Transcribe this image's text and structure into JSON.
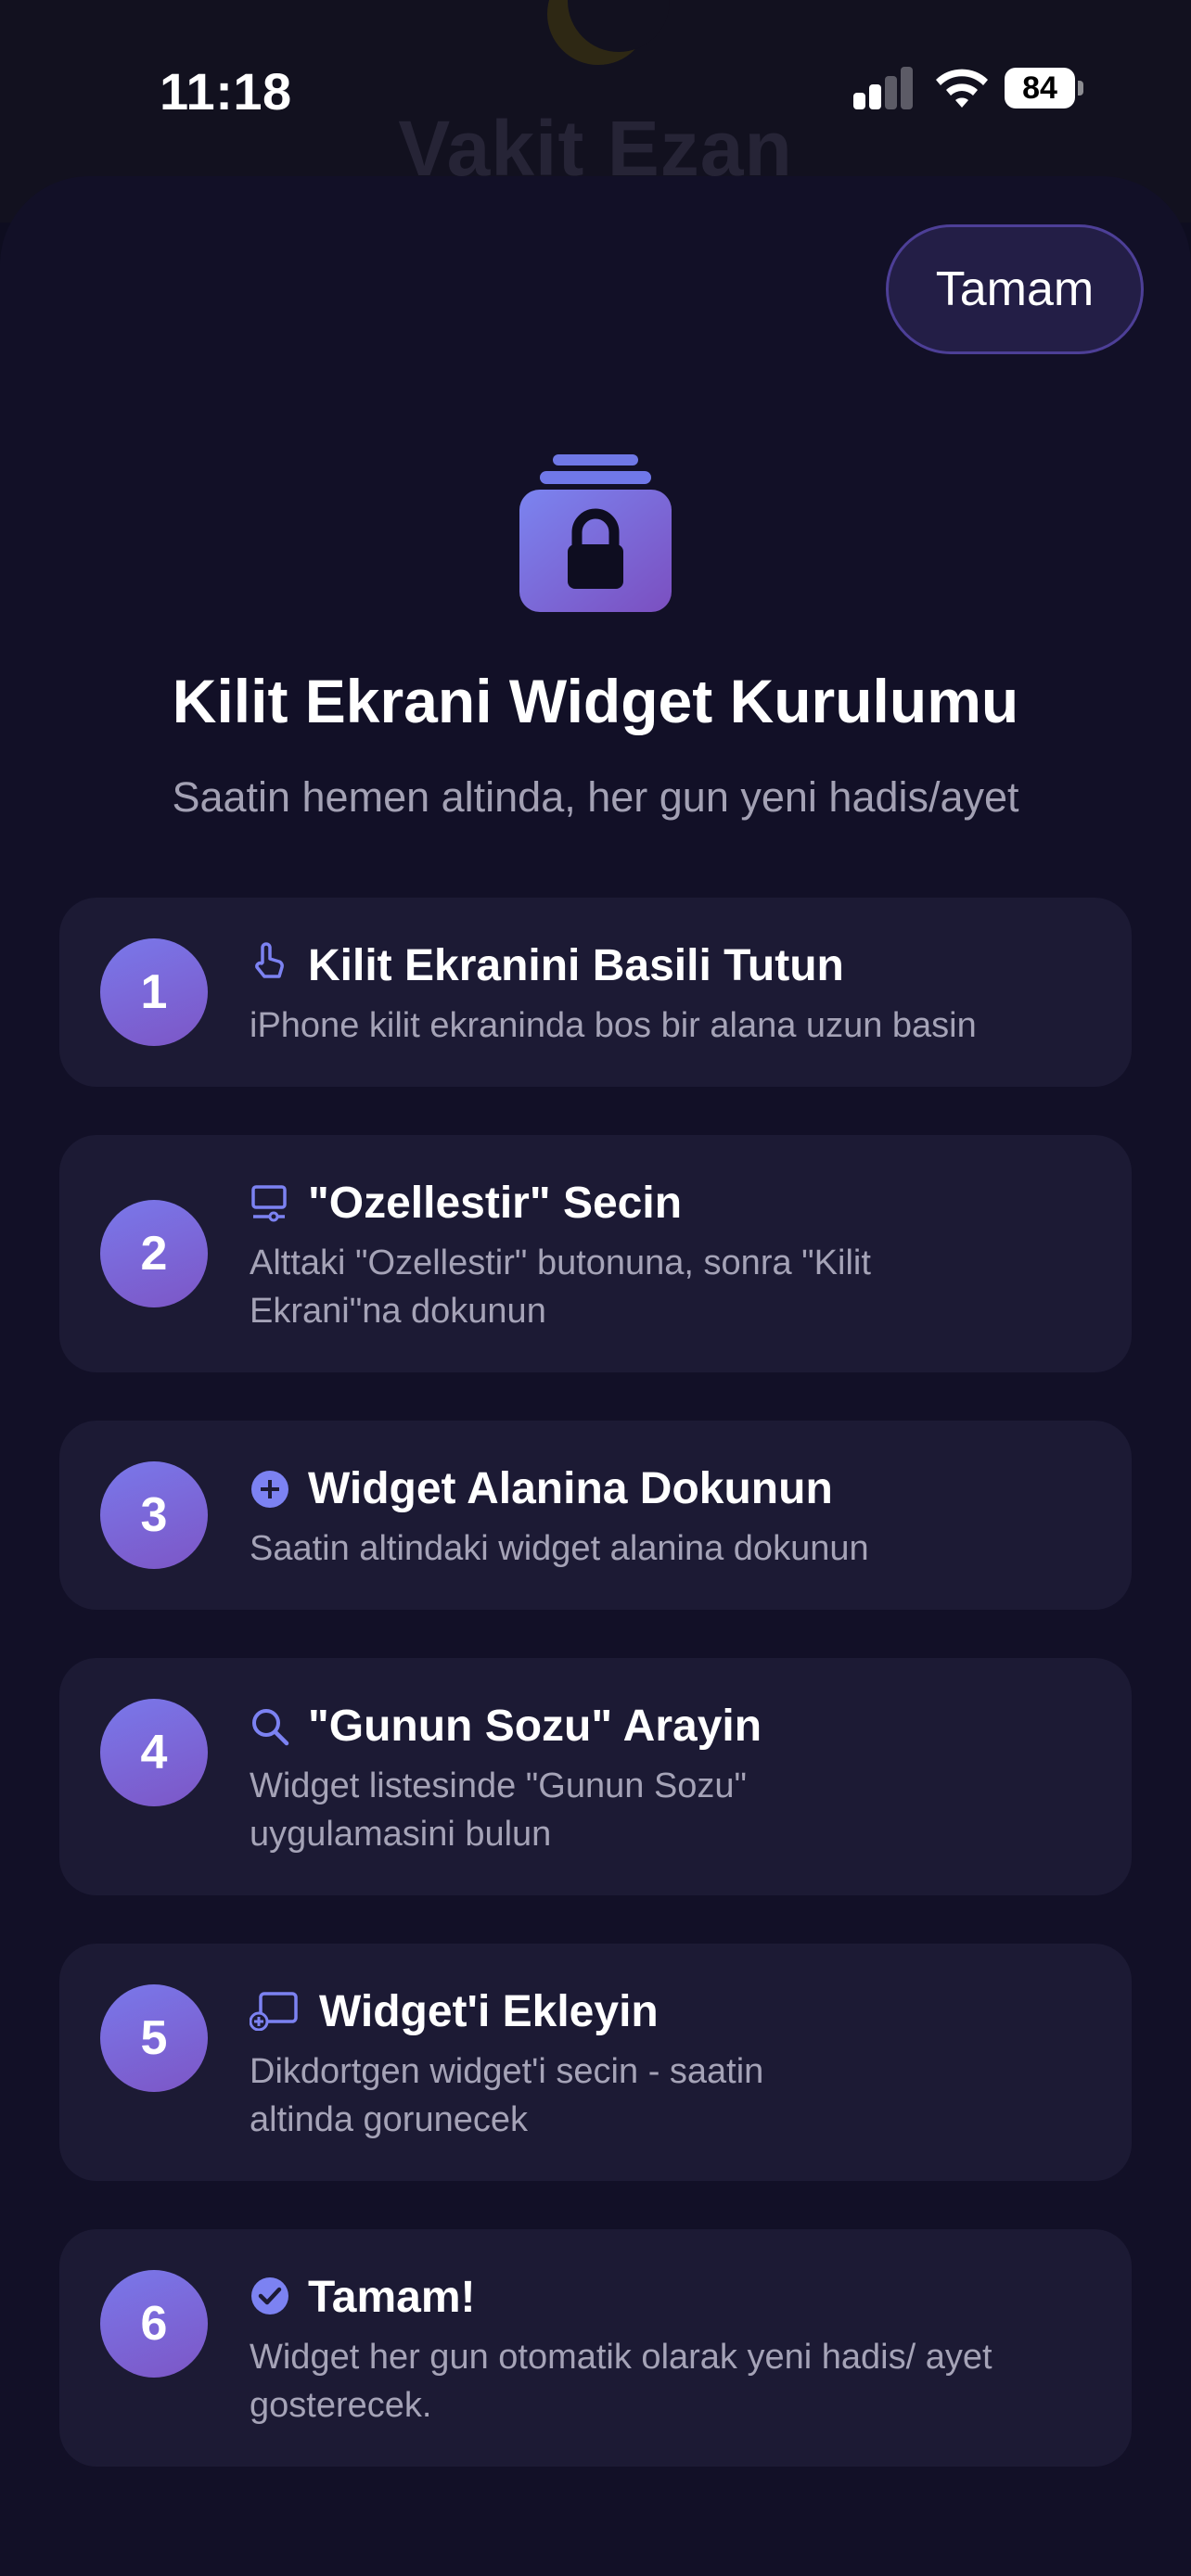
{
  "status_bar": {
    "time": "11:18",
    "battery": "84"
  },
  "background_app": {
    "title": "Vakit Ezan"
  },
  "sheet": {
    "done_label": "Tamam",
    "hero_icon": "lock-stack-icon",
    "title": "Kilit Ekrani Widget Kurulumu",
    "subtitle": "Saatin hemen altinda, her gun yeni hadis/ayet",
    "steps": [
      {
        "number": "1",
        "icon": "hand-tap-icon",
        "title": "Kilit Ekranini Basili Tutun",
        "desc": "iPhone kilit ekraninda bos bir alana uzun basin"
      },
      {
        "number": "2",
        "icon": "display-slider-icon",
        "title": "\"Ozellestir\" Secin",
        "desc": "Alttaki \"Ozellestir\" butonuna, sonra \"Kilit Ekrani\"na dokunun"
      },
      {
        "number": "3",
        "icon": "plus-circle-icon",
        "title": "Widget Alanina Dokunun",
        "desc": "Saatin altindaki widget alanina dokunun"
      },
      {
        "number": "4",
        "icon": "search-icon",
        "title": "\"Gunun Sozu\" Arayin",
        "desc": "Widget listesinde \"Gunun Sozu\" uygulamasini bulun"
      },
      {
        "number": "5",
        "icon": "rectangle-add-icon",
        "title": "Widget'i Ekleyin",
        "desc": "Dikdortgen widget'i secin - saatin altinda gorunecek"
      },
      {
        "number": "6",
        "icon": "checkmark-seal-icon",
        "title": "Tamam!",
        "desc": "Widget her gun otomatik olarak yeni hadis/ ayet gosterecek."
      }
    ]
  },
  "colors": {
    "accent": "#7a78ea",
    "accent_purple": "#7c56c6",
    "card": "#1c1a34",
    "sheet": "#121027"
  }
}
